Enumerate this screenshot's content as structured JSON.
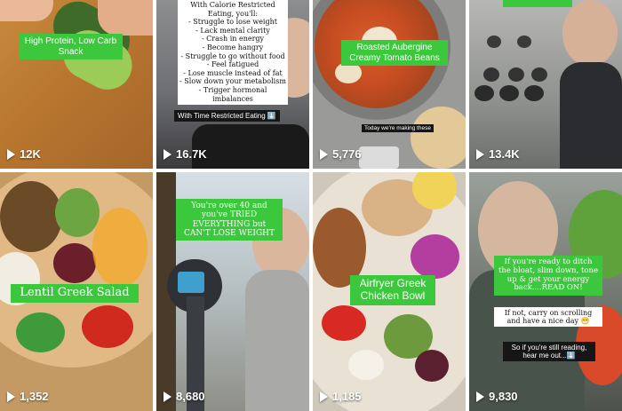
{
  "tiles": [
    {
      "caption": "High Protein, Low Carb Snack",
      "views": "12K"
    },
    {
      "text_lines": [
        "With Calorie Restricted",
        "Eating, you'll:",
        "- Struggle to lose weight",
        "- Lack mental clarity",
        "- Crash in energy",
        "- Become hangry",
        "- Struggle to go without food",
        "- Feel fatigued",
        "- Lose muscle instead of fat",
        "- Slow down your metabolism",
        "- Trigger hormonal imbalances"
      ],
      "caption": "With Time Restricted Eating ⬇️",
      "views": "16.7K"
    },
    {
      "caption": "Roasted Aubergine Creamy Tomato Beans",
      "sub": "Today we're making these",
      "views": "5,776"
    },
    {
      "caption": "",
      "views": "13.4K"
    },
    {
      "caption": "Lentil Greek Salad",
      "views": "1,352"
    },
    {
      "caption": "You're over 40 and you've TRIED EVERYTHING but CAN'T LOSE WEIGHT",
      "views": "8,680"
    },
    {
      "caption": "Airfryer Greek Chicken Bowl",
      "views": "1,185"
    },
    {
      "caption": "If you're ready to ditch the bloat, slim down, tone up & get your energy back....READ ON!",
      "sub1": "If not, carry on scrolling and have a nice day 😁",
      "sub2": "So if you're still reading, hear me out...⬇️",
      "views": "9,830"
    }
  ],
  "icons": {
    "views": "play-icon"
  }
}
